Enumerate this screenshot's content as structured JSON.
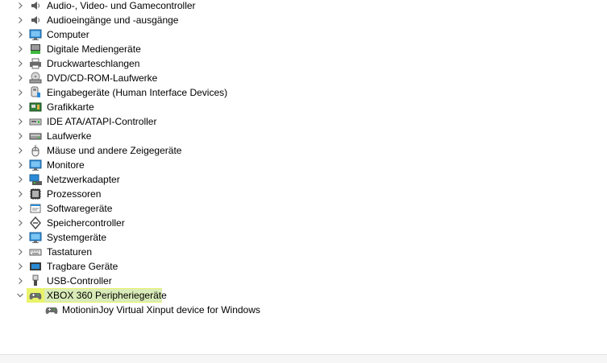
{
  "tree": {
    "items": [
      {
        "label": "Audio-, Video- und Gamecontroller",
        "icon": "speaker-icon",
        "expanded": false
      },
      {
        "label": "Audioeingänge und -ausgänge",
        "icon": "speaker-icon",
        "expanded": false
      },
      {
        "label": "Computer",
        "icon": "monitor-icon",
        "expanded": false
      },
      {
        "label": "Digitale Mediengeräte",
        "icon": "media-device-icon",
        "expanded": false
      },
      {
        "label": "Druckwarteschlangen",
        "icon": "printer-icon",
        "expanded": false
      },
      {
        "label": "DVD/CD-ROM-Laufwerke",
        "icon": "disc-drive-icon",
        "expanded": false
      },
      {
        "label": "Eingabegeräte (Human Interface Devices)",
        "icon": "hid-icon",
        "expanded": false
      },
      {
        "label": "Grafikkarte",
        "icon": "graphics-card-icon",
        "expanded": false
      },
      {
        "label": "IDE ATA/ATAPI-Controller",
        "icon": "ide-controller-icon",
        "expanded": false
      },
      {
        "label": "Laufwerke",
        "icon": "drive-icon",
        "expanded": false
      },
      {
        "label": "Mäuse und andere Zeigegeräte",
        "icon": "mouse-icon",
        "expanded": false
      },
      {
        "label": "Monitore",
        "icon": "monitor-icon",
        "expanded": false
      },
      {
        "label": "Netzwerkadapter",
        "icon": "network-adapter-icon",
        "expanded": false
      },
      {
        "label": "Prozessoren",
        "icon": "processor-icon",
        "expanded": false
      },
      {
        "label": "Softwaregeräte",
        "icon": "software-device-icon",
        "expanded": false
      },
      {
        "label": "Speichercontroller",
        "icon": "storage-controller-icon",
        "expanded": false
      },
      {
        "label": "Systemgeräte",
        "icon": "monitor-icon",
        "expanded": false
      },
      {
        "label": "Tastaturen",
        "icon": "keyboard-icon",
        "expanded": false
      },
      {
        "label": "Tragbare Geräte",
        "icon": "portable-device-icon",
        "expanded": false
      },
      {
        "label": "USB-Controller",
        "icon": "usb-icon",
        "expanded": false
      },
      {
        "label": "XBOX 360 Peripheriegeräte",
        "icon": "gamepad-icon",
        "expanded": true,
        "selected": true,
        "children": [
          {
            "label": "MotioninJoy Virtual Xinput device for Windows",
            "icon": "gamepad-icon"
          }
        ]
      }
    ]
  },
  "colors": {
    "highlight": "#e9f36a",
    "selection": "#cce4f7",
    "chevron": "#707070"
  }
}
